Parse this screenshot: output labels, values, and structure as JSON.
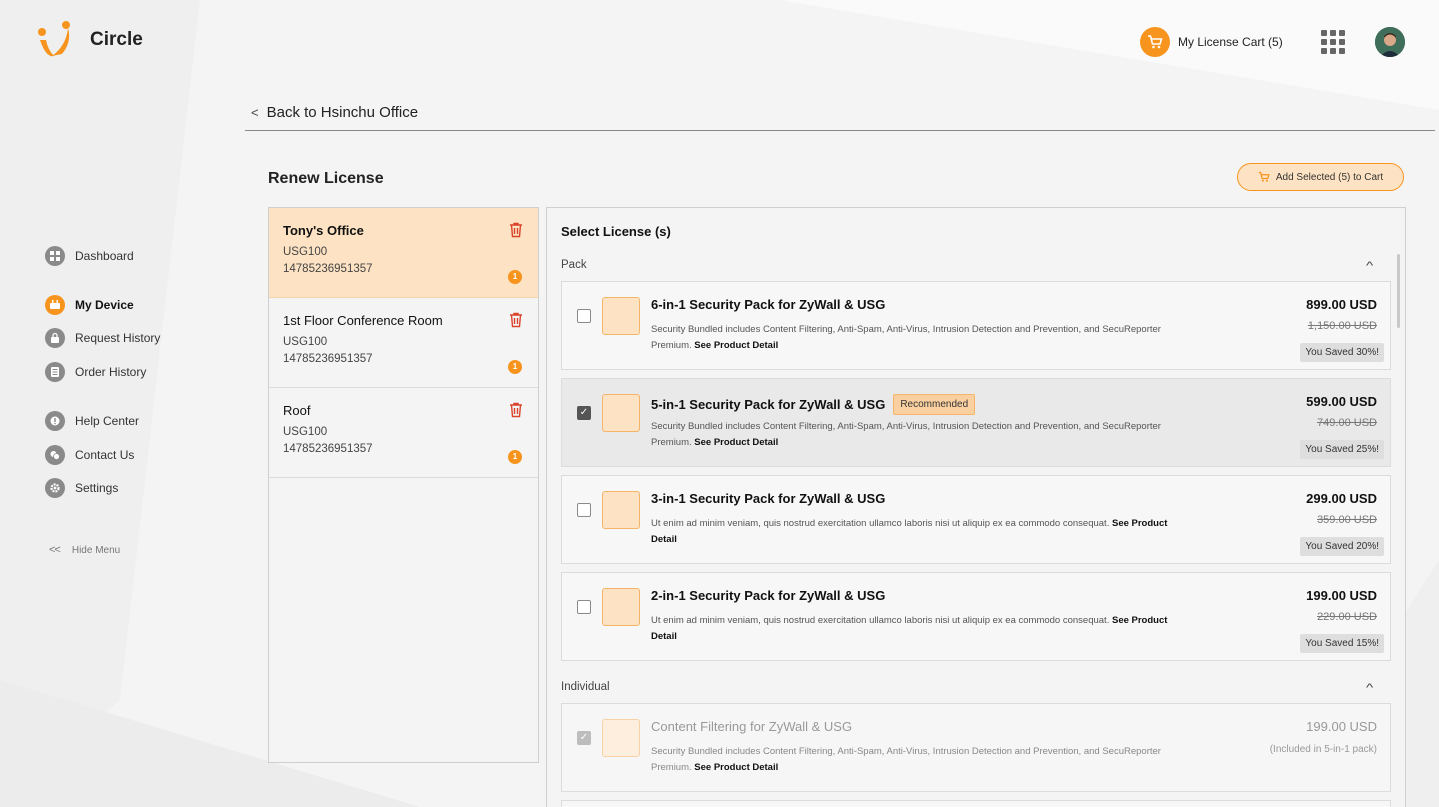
{
  "app": {
    "name": "Circle"
  },
  "header": {
    "cart_label": "My License Cart (5)"
  },
  "sidebar": {
    "items": [
      {
        "label": "Dashboard",
        "icon": "dashboard-icon",
        "active": false
      },
      {
        "label": "My Device",
        "icon": "device-icon",
        "active": true
      },
      {
        "label": "Request History",
        "icon": "lock-icon",
        "active": false
      },
      {
        "label": "Order History",
        "icon": "list-icon",
        "active": false
      },
      {
        "label": "Help Center",
        "icon": "help-icon",
        "active": false
      },
      {
        "label": "Contact Us",
        "icon": "chat-icon",
        "active": false
      },
      {
        "label": "Settings",
        "icon": "gear-icon",
        "active": false
      }
    ],
    "hide_menu": "Hide Menu"
  },
  "breadcrumb": {
    "back_label": "Back to Hsinchu Office"
  },
  "page": {
    "title": "Renew License",
    "add_button": "Add Selected (5) to Cart"
  },
  "devices": [
    {
      "name": "Tony's Office",
      "model": "USG100",
      "serial": "14785236951357",
      "badge": "1",
      "selected": true
    },
    {
      "name": "1st Floor Conference Room",
      "model": "USG100",
      "serial": "14785236951357",
      "badge": "1",
      "selected": false
    },
    {
      "name": "Roof",
      "model": "USG100",
      "serial": "14785236951357",
      "badge": "1",
      "selected": false
    }
  ],
  "licenses": {
    "title": "Select License (s)",
    "pack_label": "Pack",
    "individual_label": "Individual",
    "link_label": "See Product Detail",
    "packs": [
      {
        "title": "6-in-1 Security Pack for ZyWall & USG",
        "badge": "",
        "desc": "Security Bundled includes Content Filtering, Anti-Spam, Anti-Virus, Intrusion Detection and Prevention, and SecuReporter Premium.",
        "price": "899.00 USD",
        "old_price": "1,150.00 USD",
        "saved": "You Saved 30%!",
        "checked": false
      },
      {
        "title": "5-in-1 Security Pack for ZyWall & USG",
        "badge": "Recommended",
        "desc": "Security Bundled includes Content Filtering, Anti-Spam, Anti-Virus, Intrusion Detection and Prevention, and SecuReporter Premium.",
        "price": "599.00 USD",
        "old_price": "749.00 USD",
        "saved": "You Saved 25%!",
        "checked": true
      },
      {
        "title": "3-in-1 Security Pack for ZyWall & USG",
        "badge": "",
        "desc": "Ut enim ad minim veniam, quis nostrud exercitation ullamco laboris nisi ut aliquip ex ea commodo consequat.",
        "price": "299.00 USD",
        "old_price": "359.00 USD",
        "saved": "You Saved 20%!",
        "checked": false
      },
      {
        "title": "2-in-1 Security Pack  for ZyWall & USG",
        "badge": "",
        "desc": "Ut enim ad minim veniam, quis nostrud exercitation ullamco laboris nisi ut aliquip ex ea commodo consequat.",
        "price": "199.00 USD",
        "old_price": "229.00 USD",
        "saved": "You Saved 15%!",
        "checked": false
      }
    ],
    "individual": [
      {
        "title": "Content Filtering for ZyWall & USG",
        "desc": "Security Bundled includes Content Filtering, Anti-Spam, Anti-Virus, Intrusion Detection and Prevention, and SecuReporter Premium.",
        "price": "199.00 USD",
        "note": "(Included in 5-in-1 pack)",
        "checked": true,
        "disabled": true
      }
    ]
  },
  "colors": {
    "accent": "#f7941d",
    "accent_light": "#fde3c3",
    "text": "#222222"
  }
}
